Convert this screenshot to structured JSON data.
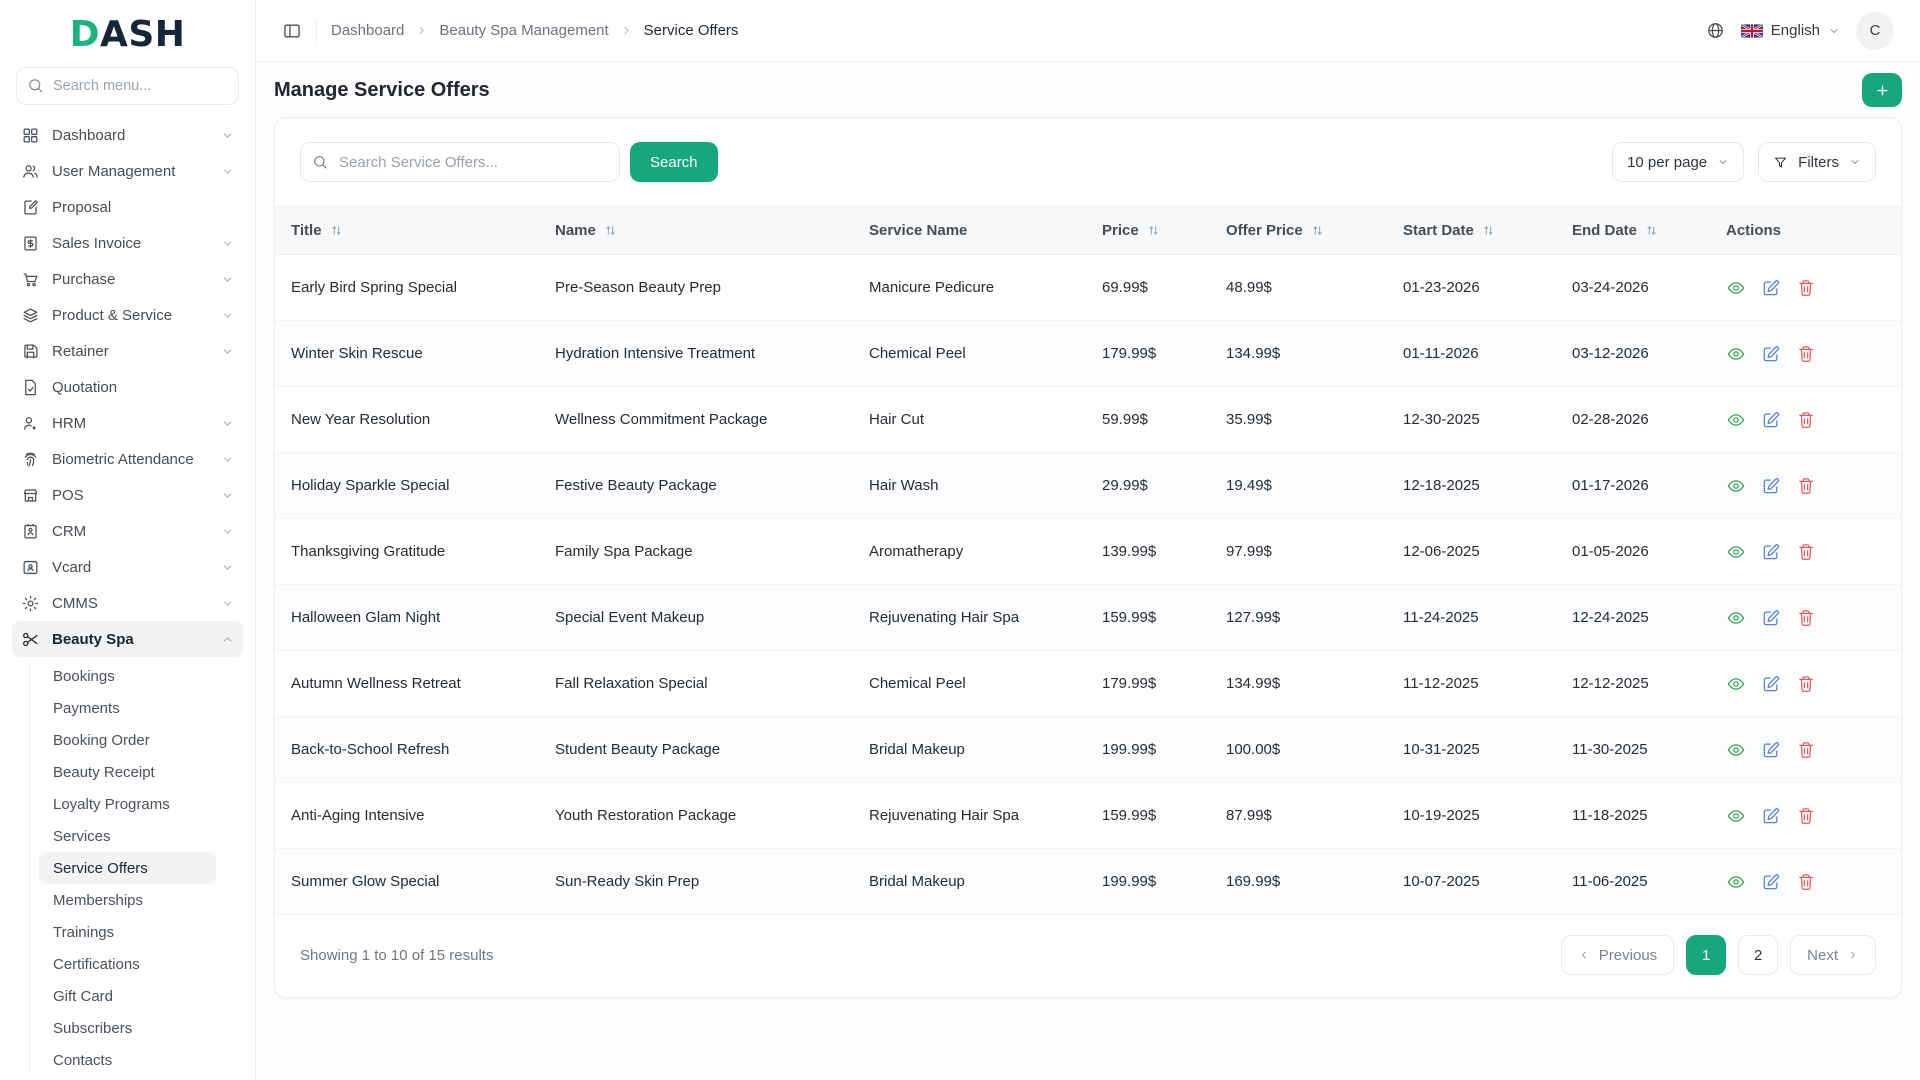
{
  "colors": {
    "accent_green": "#16A87C",
    "logo_green": "#1CB47E",
    "logo_navy": "#15263B",
    "view_icon": "#2CA44E",
    "edit_icon": "#4F7DE3",
    "delete_icon": "#E25C5C"
  },
  "brand": {
    "logo_first": "D",
    "logo_rest": "ASH"
  },
  "sidebar": {
    "search_placeholder": "Search menu...",
    "items": [
      {
        "label": "Dashboard",
        "icon": "dashboard",
        "chevron": true
      },
      {
        "label": "User Management",
        "icon": "users",
        "chevron": true
      },
      {
        "label": "Proposal",
        "icon": "proposal",
        "chevron": false
      },
      {
        "label": "Sales Invoice",
        "icon": "sales-invoice",
        "chevron": true
      },
      {
        "label": "Purchase",
        "icon": "purchase",
        "chevron": true
      },
      {
        "label": "Product & Service",
        "icon": "product-service",
        "chevron": true
      },
      {
        "label": "Retainer",
        "icon": "retainer",
        "chevron": true
      },
      {
        "label": "Quotation",
        "icon": "quotation",
        "chevron": false
      },
      {
        "label": "HRM",
        "icon": "hrm",
        "chevron": true
      },
      {
        "label": "Biometric Attendance",
        "icon": "biometric",
        "chevron": true
      },
      {
        "label": "POS",
        "icon": "pos",
        "chevron": true
      },
      {
        "label": "CRM",
        "icon": "crm",
        "chevron": true
      },
      {
        "label": "Vcard",
        "icon": "vcard",
        "chevron": true
      },
      {
        "label": "CMMS",
        "icon": "cmms",
        "chevron": true
      },
      {
        "label": "Beauty Spa",
        "icon": "scissors",
        "chevron": true,
        "expanded": true,
        "active": true,
        "submenu": [
          {
            "label": "Bookings"
          },
          {
            "label": "Payments"
          },
          {
            "label": "Booking Order"
          },
          {
            "label": "Beauty Receipt"
          },
          {
            "label": "Loyalty Programs"
          },
          {
            "label": "Services"
          },
          {
            "label": "Service Offers",
            "active": true
          },
          {
            "label": "Memberships"
          },
          {
            "label": "Trainings"
          },
          {
            "label": "Certifications"
          },
          {
            "label": "Gift Card"
          },
          {
            "label": "Subscribers"
          },
          {
            "label": "Contacts"
          }
        ]
      }
    ]
  },
  "topbar": {
    "breadcrumb": [
      "Dashboard",
      "Beauty Spa Management",
      "Service Offers"
    ],
    "language": "English",
    "avatar": "C"
  },
  "page": {
    "title": "Manage Service Offers"
  },
  "toolbar": {
    "search_placeholder": "Search Service Offers...",
    "search_button": "Search",
    "per_page": "10 per page",
    "filters": "Filters"
  },
  "table": {
    "headers": [
      {
        "label": "Title",
        "sortable": true
      },
      {
        "label": "Name",
        "sortable": true
      },
      {
        "label": "Service Name",
        "sortable": false
      },
      {
        "label": "Price",
        "sortable": true
      },
      {
        "label": "Offer Price",
        "sortable": true
      },
      {
        "label": "Start Date",
        "sortable": true
      },
      {
        "label": "End Date",
        "sortable": true
      },
      {
        "label": "Actions",
        "sortable": false
      }
    ],
    "row_fields": [
      "title",
      "name",
      "service",
      "price",
      "offer_price",
      "start",
      "end"
    ],
    "rows": [
      {
        "title": "Early Bird Spring Special",
        "name": "Pre-Season Beauty Prep",
        "service": "Manicure Pedicure",
        "price": "69.99$",
        "offer_price": "48.99$",
        "start": "01-23-2026",
        "end": "03-24-2026"
      },
      {
        "title": "Winter Skin Rescue",
        "name": "Hydration Intensive Treatment",
        "service": "Chemical Peel",
        "price": "179.99$",
        "offer_price": "134.99$",
        "start": "01-11-2026",
        "end": "03-12-2026"
      },
      {
        "title": "New Year Resolution",
        "name": "Wellness Commitment Package",
        "service": "Hair Cut",
        "price": "59.99$",
        "offer_price": "35.99$",
        "start": "12-30-2025",
        "end": "02-28-2026"
      },
      {
        "title": "Holiday Sparkle Special",
        "name": "Festive Beauty Package",
        "service": "Hair Wash",
        "price": "29.99$",
        "offer_price": "19.49$",
        "start": "12-18-2025",
        "end": "01-17-2026"
      },
      {
        "title": "Thanksgiving Gratitude",
        "name": "Family Spa Package",
        "service": "Aromatherapy",
        "price": "139.99$",
        "offer_price": "97.99$",
        "start": "12-06-2025",
        "end": "01-05-2026"
      },
      {
        "title": "Halloween Glam Night",
        "name": "Special Event Makeup",
        "service": "Rejuvenating Hair Spa",
        "price": "159.99$",
        "offer_price": "127.99$",
        "start": "11-24-2025",
        "end": "12-24-2025"
      },
      {
        "title": "Autumn Wellness Retreat",
        "name": "Fall Relaxation Special",
        "service": "Chemical Peel",
        "price": "179.99$",
        "offer_price": "134.99$",
        "start": "11-12-2025",
        "end": "12-12-2025"
      },
      {
        "title": "Back-to-School Refresh",
        "name": "Student Beauty Package",
        "service": "Bridal Makeup",
        "price": "199.99$",
        "offer_price": "100.00$",
        "start": "10-31-2025",
        "end": "11-30-2025"
      },
      {
        "title": "Anti-Aging Intensive",
        "name": "Youth Restoration Package",
        "service": "Rejuvenating Hair Spa",
        "price": "159.99$",
        "offer_price": "87.99$",
        "start": "10-19-2025",
        "end": "11-18-2025"
      },
      {
        "title": "Summer Glow Special",
        "name": "Sun-Ready Skin Prep",
        "service": "Bridal Makeup",
        "price": "199.99$",
        "offer_price": "169.99$",
        "start": "10-07-2025",
        "end": "11-06-2025"
      }
    ],
    "actions": [
      "view",
      "edit",
      "delete"
    ]
  },
  "pagination": {
    "summary": "Showing 1 to 10 of 15 results",
    "previous": "Previous",
    "next": "Next",
    "pages": [
      "1",
      "2"
    ],
    "active": "1"
  }
}
